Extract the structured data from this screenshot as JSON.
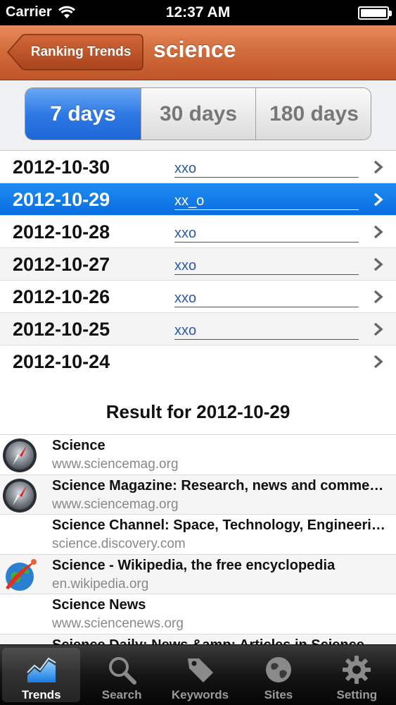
{
  "status": {
    "carrier": "Carrier",
    "time": "12:37 AM"
  },
  "nav": {
    "back_label": "Ranking Trends",
    "title": "science"
  },
  "segments": [
    {
      "label": "7 days",
      "active": true
    },
    {
      "label": "30 days",
      "active": false
    },
    {
      "label": "180 days",
      "active": false
    }
  ],
  "dates": [
    {
      "date": "2012-10-30",
      "trend": "xxo",
      "selected": false
    },
    {
      "date": "2012-10-29",
      "trend": "xx_o",
      "selected": true
    },
    {
      "date": "2012-10-28",
      "trend": "xxo",
      "selected": false
    },
    {
      "date": "2012-10-27",
      "trend": "xxo",
      "selected": false
    },
    {
      "date": "2012-10-26",
      "trend": "xxo",
      "selected": false
    },
    {
      "date": "2012-10-25",
      "trend": "xxo",
      "selected": false
    },
    {
      "date": "2012-10-24",
      "trend": "",
      "selected": false
    }
  ],
  "result_header": "Result for 2012-10-29",
  "results": [
    {
      "title": "Science",
      "url": "www.sciencemag.org",
      "icon": "safari-compass-icon"
    },
    {
      "title": "Science Magazine: Research, news and commentary",
      "url": "www.sciencemag.org",
      "icon": "safari-compass-icon"
    },
    {
      "title": "Science Channel: Space, Technology, Engineering",
      "url": "science.discovery.com",
      "icon": ""
    },
    {
      "title": "Science - Wikipedia, the free encyclopedia",
      "url": "en.wikipedia.org",
      "icon": "globe-comet-icon"
    },
    {
      "title": "Science News",
      "url": "www.sciencenews.org",
      "icon": ""
    },
    {
      "title": "Science Daily: News &amp; Articles in Science",
      "url": "",
      "icon": ""
    }
  ],
  "tabs": [
    {
      "label": "Trends",
      "icon": "chart-icon",
      "active": true
    },
    {
      "label": "Search",
      "icon": "magnifier-icon",
      "active": false
    },
    {
      "label": "Keywords",
      "icon": "tag-icon",
      "active": false
    },
    {
      "label": "Sites",
      "icon": "globe-icon",
      "active": false
    },
    {
      "label": "Setting",
      "icon": "gear-icon",
      "active": false
    }
  ]
}
